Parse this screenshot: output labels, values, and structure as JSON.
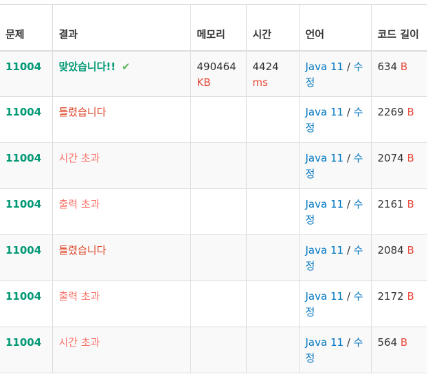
{
  "headers": {
    "problem": "문제",
    "result": "결과",
    "memory": "메모리",
    "time": "시간",
    "language": "언어",
    "code_length": "코드 길이"
  },
  "check_symbol": "✔",
  "rows": [
    {
      "problem": "11004",
      "result": "맞았습니다!!",
      "memory": "490464",
      "memory_unit": "KB",
      "time": "4424",
      "time_unit": "ms",
      "language": "Java 11",
      "separator": " / ",
      "edit": "수정",
      "code": "634",
      "code_unit": "B"
    },
    {
      "problem": "11004",
      "result": "틀렸습니다",
      "memory": "",
      "memory_unit": "",
      "time": "",
      "time_unit": "",
      "language": "Java 11",
      "separator": " / ",
      "edit": "수정",
      "code": "2269",
      "code_unit": "B"
    },
    {
      "problem": "11004",
      "result": "시간 초과",
      "memory": "",
      "memory_unit": "",
      "time": "",
      "time_unit": "",
      "language": "Java 11",
      "separator": " / ",
      "edit": "수정",
      "code": "2074",
      "code_unit": "B"
    },
    {
      "problem": "11004",
      "result": "출력 초과",
      "memory": "",
      "memory_unit": "",
      "time": "",
      "time_unit": "",
      "language": "Java 11",
      "separator": " / ",
      "edit": "수정",
      "code": "2161",
      "code_unit": "B"
    },
    {
      "problem": "11004",
      "result": "틀렸습니다",
      "memory": "",
      "memory_unit": "",
      "time": "",
      "time_unit": "",
      "language": "Java 11",
      "separator": " / ",
      "edit": "수정",
      "code": "2084",
      "code_unit": "B"
    },
    {
      "problem": "11004",
      "result": "출력 초과",
      "memory": "",
      "memory_unit": "",
      "time": "",
      "time_unit": "",
      "language": "Java 11",
      "separator": " / ",
      "edit": "수정",
      "code": "2172",
      "code_unit": "B"
    },
    {
      "problem": "11004",
      "result": "시간 초과",
      "memory": "",
      "memory_unit": "",
      "time": "",
      "time_unit": "",
      "language": "Java 11",
      "separator": " / ",
      "edit": "수정",
      "code": "564",
      "code_unit": "B"
    }
  ]
}
